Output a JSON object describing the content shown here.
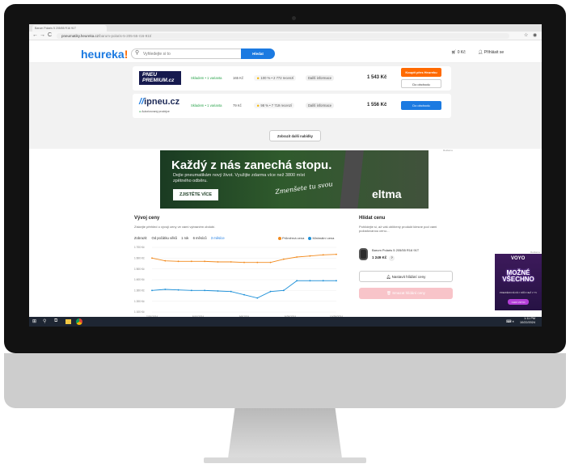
{
  "browser": {
    "tab_title": "Barum Polaris 5 205/55 R16 91T",
    "url_host": "pneumatiky.heureka.cz",
    "url_path": "/barum-polaris-5-205-55-r16-91t/",
    "nav_back": "←",
    "nav_forward": "→",
    "nav_reload": "C"
  },
  "header": {
    "logo": "heureka",
    "logo_accent": "!",
    "search_placeholder": "Vyhledejte si to",
    "search_button": "Hledat",
    "cart_label": "0 Kč",
    "login_label": "Přihlásit se"
  },
  "offers": [
    {
      "shop_logo_line1": "PNEU",
      "shop_logo_line2": "PREMIUM.cz",
      "stock": "Skladem • 1 varianta",
      "shipping": "165 Kč",
      "rating": "100 % • 2 772 recenzí",
      "more_info": "Další informace",
      "price": "1 543 Kč",
      "buy_button": "Koupit přes Heureku",
      "shop_button": "Do obchodu"
    },
    {
      "shop_logo_mark": "//",
      "shop_logo": "ipneu.cz",
      "verified": "Autorizovaný prodejce",
      "stock": "Skladem • 1 varianta",
      "shipping": "79 Kč",
      "rating": "98 % • 7 719 recenzí",
      "more_info": "Další informace",
      "price": "1 556 Kč",
      "shop_button": "Do obchodu"
    }
  ],
  "show_more": "Zobrazit další nabídky",
  "ad_label": "Reklama",
  "banner": {
    "title": "Každý z nás zanechá stopu.",
    "subtitle": "Dejte pneumatikám nový život. Využijte zdarma více než 3800 míst zpětného odběru.",
    "cta": "ZJISTĚTE VÍCE",
    "script": "Zmenšete tu svou",
    "brand": "eltma"
  },
  "price_history": {
    "title": "Vývoj ceny",
    "subtitle": "Získejte přehled o vývoji ceny ve vámi vybraném období.",
    "period_label": "Zobrazit:",
    "periods": [
      "Od počátku věků",
      "1 rok",
      "6 měsíců",
      "3 měsíce"
    ],
    "active_period": "3 měsíce",
    "legend_avg": "Průměrná cena",
    "legend_min": "Minimální cena"
  },
  "chart_data": {
    "type": "line",
    "x": [
      "7/20/2024",
      "7/27/2024",
      "8/3/2024",
      "8/10/2024",
      "8/17/2024",
      "8/24/2024",
      "8/31/2024",
      "9/7/2024",
      "9/14/2024",
      "9/21/2024",
      "9/28/2024",
      "10/5/2024",
      "10/12/2024",
      "10/19/2024",
      "10/26/2024"
    ],
    "tick_labels_x": [
      "7/20/2024",
      "8/10/2024",
      "9/8/2024",
      "9/29/2024",
      "10/29/2024"
    ],
    "tick_labels_y": [
      "1 700 Kč",
      "1 600 Kč",
      "1 500 Kč",
      "1 400 Kč",
      "1 300 Kč",
      "1 200 Kč",
      "1 100 Kč"
    ],
    "ylim": [
      1100,
      1700
    ],
    "series": [
      {
        "name": "Průměrná cena",
        "color": "#f28a1d",
        "values": [
          1600,
          1575,
          1570,
          1570,
          1570,
          1565,
          1565,
          1560,
          1560,
          1560,
          1590,
          1610,
          1620,
          1630,
          1635
        ]
      },
      {
        "name": "Minimální cena",
        "color": "#1b8fd8",
        "values": [
          1300,
          1310,
          1305,
          1300,
          1300,
          1295,
          1290,
          1260,
          1230,
          1290,
          1300,
          1390,
          1390,
          1390,
          1390
        ]
      }
    ]
  },
  "watch": {
    "title": "Hlídat cenu",
    "subtitle": "Pohlídejte si, až váš oblíbený produkt klesne pod vámi požadovanou cenu…",
    "product_name": "Barum Polaris 5 205/55 R16 91T",
    "product_price": "1 249 Kč",
    "help": "?",
    "set_alert": "Nastavit hlídání ceny",
    "cancel_alert": "Smazat hlídání ceny"
  },
  "side_ad": {
    "label": "Reklama",
    "brand": "VOYO",
    "title": "MOŽNÉ VŠECHNO",
    "subtitle": "PREMIÉROVÉ DÍLY DŘÍV NEŽ V TV",
    "button": "CHCI VOYO"
  },
  "taskbar": {
    "time": "1:11 PM",
    "date": "10/22/2024"
  }
}
